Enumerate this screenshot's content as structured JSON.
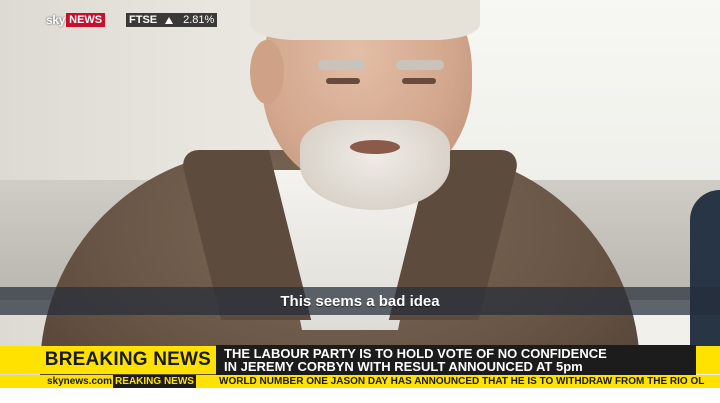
{
  "channel": {
    "logo_sky": "sky",
    "logo_news": "NEWS",
    "market_index": "FTSE",
    "market_direction_icon": "up-triangle-icon",
    "market_change": "2.81%"
  },
  "subtitle": "This seems a bad idea",
  "lower_third": {
    "breaking_label": "BREAKING NEWS",
    "headline_line1": "THE LABOUR PARTY IS TO HOLD VOTE OF NO CONFIDENCE",
    "headline_line2": "IN JEREMY CORBYN WITH RESULT ANNOUNCED AT 5pm",
    "website": "skynews.com",
    "section_tag": "REAKING NEWS",
    "ticker": "WORLD NUMBER ONE JASON DAY HAS ANNOUNCED THAT HE IS TO WITHDRAW FROM THE RIO OL"
  },
  "colors": {
    "breaking_yellow": "#ffe200",
    "sky_news_red": "#c8102e",
    "headline_bg": "#1c1c1c"
  }
}
